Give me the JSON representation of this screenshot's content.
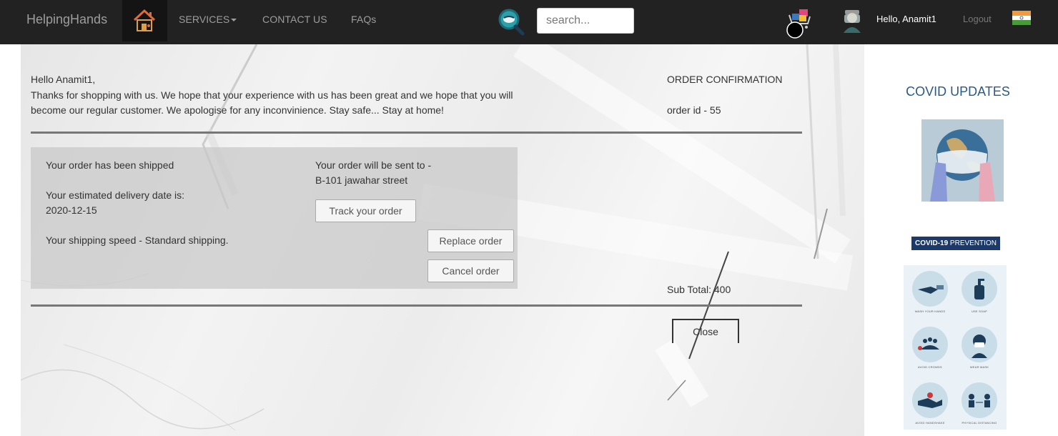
{
  "navbar": {
    "brand": "HelpingHands",
    "links": [
      {
        "label": "SERVICES",
        "dropdown": true
      },
      {
        "label": "CONTACT US"
      },
      {
        "label": "FAQs"
      }
    ],
    "search": {
      "placeholder": "search..."
    },
    "greeting": "Hello, Anamit1",
    "logout": "Logout",
    "icons": [
      "home-logo-icon",
      "mask-search-icon",
      "cart-icon",
      "avatar-icon",
      "india-flag-icon"
    ]
  },
  "confirmation": {
    "greeting": "Hello Anamit1,",
    "message": "Thanks for shopping with us. We hope that your experience with us has been great and we hope that you will become our regular customer. We apologise for any inconvinience. Stay safe... Stay at home!",
    "title": "ORDER CONFIRMATION",
    "order_id": "order id - 55",
    "status": "Your order has been shipped",
    "delivery_label": "Your estimated delivery date is:",
    "delivery_date": "2020-12-15",
    "shipping_speed": "Your shipping speed - Standard shipping.",
    "address_label": "Your order will be sent to -",
    "address": "B-101 jawahar street",
    "buttons": {
      "track": "Track your order",
      "replace": "Replace order",
      "cancel": "Cancel order",
      "close": "Close"
    },
    "subtotal": "Sub Total: 400"
  },
  "sidebar": {
    "title": "COVID UPDATES",
    "banner_bold": "COVID-19",
    "banner_rest": " PREVENTION",
    "prevention": [
      {
        "label": "WASH YOUR HANDS",
        "icon": "wash-hands-icon"
      },
      {
        "label": "USE SOAP",
        "icon": "soap-icon"
      },
      {
        "label": "AVOID CROWDS",
        "icon": "crowd-icon"
      },
      {
        "label": "WEAR MASK",
        "icon": "mask-icon"
      },
      {
        "label": "AVOID HANDSHAKE",
        "icon": "handshake-icon"
      },
      {
        "label": "PHYSICAL DISTANCING",
        "icon": "distancing-icon"
      }
    ]
  },
  "colors": {
    "navbar": "#222222",
    "nav_text": "#9d9d9d",
    "sidebar_title": "#2a5a8a",
    "banner": "#1b3a6b"
  }
}
